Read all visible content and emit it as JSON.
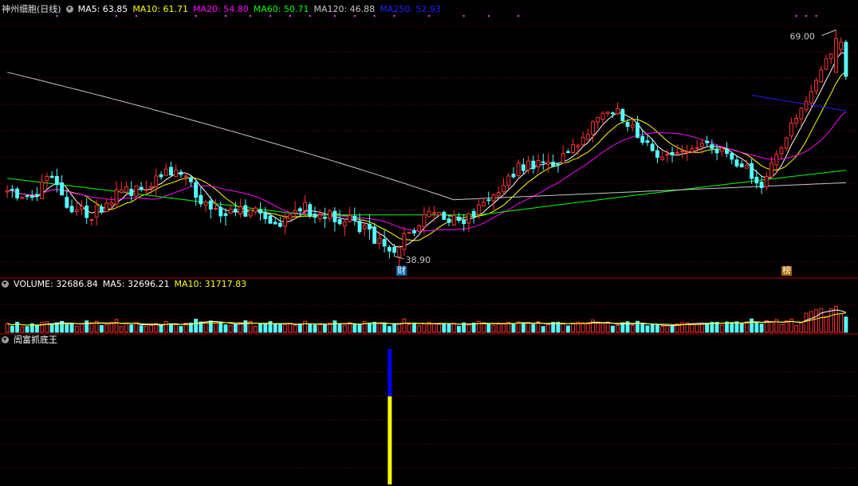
{
  "stock": {
    "title": "神州细胞(日线)"
  },
  "ma_legend": [
    {
      "label": "MA5: 63.85",
      "color": "#ffffff"
    },
    {
      "label": "MA10: 61.71",
      "color": "#ffff00"
    },
    {
      "label": "MA20: 54.80",
      "color": "#ff00ff"
    },
    {
      "label": "MA60: 50.71",
      "color": "#00ff00"
    },
    {
      "label": "MA120: 46.88",
      "color": "#c8c8c8"
    },
    {
      "label": "MA250: 52.93",
      "color": "#2020ff"
    }
  ],
  "volume_legend": [
    {
      "label": "VOLUME: 32686.84",
      "color": "#ffffff"
    },
    {
      "label": "MA5: 32696.21",
      "color": "#ffffff"
    },
    {
      "label": "MA10: 31717.83",
      "color": "#ffff00"
    }
  ],
  "indicator": {
    "title": "訚富抓底王",
    "color": "#ffffff"
  },
  "annotations": {
    "high_label": "69.00",
    "low_label": "38.90",
    "tag_left": "财",
    "tag_right": "榜"
  },
  "colors": {
    "up": "#ff3232",
    "down": "#54ffff",
    "grid": "#8b0000",
    "indicator_top": "#0000ff",
    "indicator_bottom": "#ffff00"
  },
  "chart_data": {
    "type": "candlestick",
    "y_scale": "log",
    "price_range": [
      37.5,
      71.5
    ],
    "volume_max": 50000,
    "indicator_value": 1,
    "indicator_index": 0,
    "candles": [],
    "ma_series": [
      {
        "name": "MA5",
        "color": "#ffffff"
      },
      {
        "name": "MA10",
        "color": "#ffff00"
      },
      {
        "name": "MA20",
        "color": "#ff00ff"
      },
      {
        "name": "MA60",
        "color": "#00ff00"
      },
      {
        "name": "MA120",
        "color": "#c8c8c8"
      },
      {
        "name": "MA250",
        "color": "#2020ff"
      }
    ]
  }
}
